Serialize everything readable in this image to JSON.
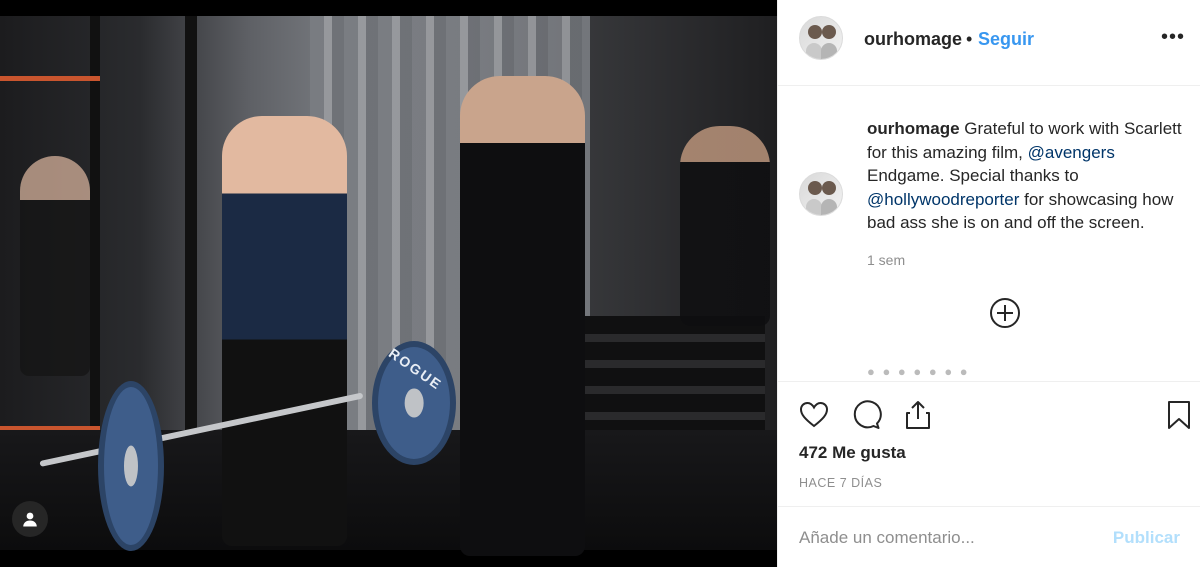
{
  "post": {
    "username": "ourhomage",
    "separator": "•",
    "follow_label": "Seguir",
    "more_label": "•••",
    "caption": {
      "username": "ourhomage",
      "text_1": "Grateful to work with Scarlett for this amazing film,",
      "mention_1": "@avengers",
      "text_2": "Endgame. Special thanks to",
      "mention_2": "@hollywoodreporter",
      "text_3": "for showcasing how bad ass she is on and off the screen."
    },
    "caption_time": "1 sem",
    "likes": "472 Me gusta",
    "posted_ago": "HACE 7 DÍAS",
    "comment_placeholder": "Añade un comentario...",
    "publish_label": "Publicar"
  },
  "photo": {
    "plate_brand": "ROGUE"
  },
  "colors": {
    "link_blue": "#3897f0",
    "mention_blue": "#003569",
    "publish_disabled": "#b2dffc",
    "secondary_text": "#8e8e8e",
    "border": "#efefef"
  },
  "icons": {
    "like": "heart-icon",
    "comment": "comment-icon",
    "share": "share-icon",
    "save": "bookmark-icon",
    "load_more": "plus-circle-icon",
    "user_tag": "user-icon"
  }
}
